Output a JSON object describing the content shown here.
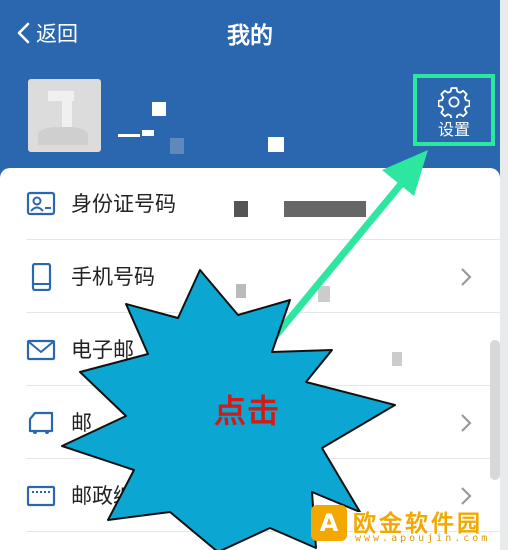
{
  "header": {
    "back_label": "返回",
    "title": "我的"
  },
  "profile": {
    "settings_label": "设置"
  },
  "menu": {
    "items": [
      {
        "label": "身份证号码",
        "icon": "id-card-icon",
        "has_chevron": false
      },
      {
        "label": "手机号码",
        "icon": "phone-icon",
        "has_chevron": true
      },
      {
        "label": "电子邮",
        "icon": "mail-icon",
        "has_chevron": false
      },
      {
        "label": "邮",
        "icon": "truck-icon",
        "has_chevron": true
      },
      {
        "label": "邮政编",
        "icon": "postcode-icon",
        "has_chevron": true
      }
    ]
  },
  "annotation": {
    "callout_text": "点击"
  },
  "watermark": {
    "logo_letter": "A",
    "name": "欧金软件园",
    "url": "www.apoujin.com"
  },
  "colors": {
    "header_bg": "#2b67ae",
    "highlight": "#2de69f",
    "callout_fill": "#0ba6d2",
    "callout_text": "#d11b16",
    "watermark": "#f2a800"
  }
}
